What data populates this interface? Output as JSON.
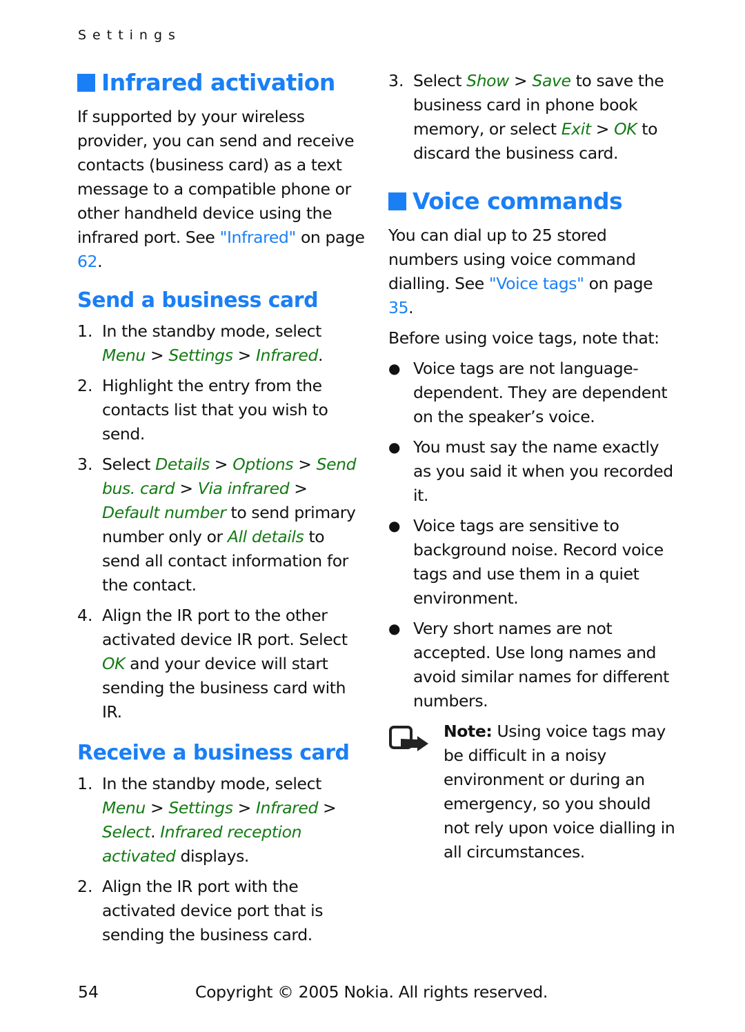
{
  "running_head": "Settings",
  "left": {
    "infrared_activation": {
      "title": "Infrared activation",
      "body_pre": "If supported by your wireless provider, you can send and receive contacts (business card) as a text message to a compatible phone or other handheld device using the infrared port. See ",
      "link_text": "\"Infrared\"",
      "on_page": " on page ",
      "page_ref": "62",
      "end": "."
    },
    "send": {
      "title": "Send a business card",
      "steps": [
        {
          "num": "1.",
          "t1": "In the standby mode, select ",
          "menu": "Menu",
          "sep1": " > ",
          "settings": "Settings",
          "sep2": " > ",
          "infrared": "Infrared",
          "end": "."
        },
        {
          "num": "2.",
          "text": "Highlight the entry from the contacts list that you wish to send."
        },
        {
          "num": "3.",
          "t1": "Select ",
          "details": "Details",
          "sep1": " > ",
          "options": "Options",
          "sep2": " > ",
          "send": "Send bus. card",
          "sep3": " > ",
          "via": "Via infrared",
          "sep4": " > ",
          "default": "Default number",
          "t2": " to send primary number only or ",
          "all": "All details",
          "t3": " to send all contact information for the contact."
        },
        {
          "num": "4.",
          "t1": "Align the IR port to the other activated device IR port. Select ",
          "ok": "OK",
          "t2": " and your device will start sending the business card with IR."
        }
      ]
    },
    "receive": {
      "title": "Receive a business card",
      "steps": [
        {
          "num": "1.",
          "t1": "In the standby mode, select ",
          "menu": "Menu",
          "sep1": " > ",
          "settings": "Settings",
          "sep2": " > ",
          "infrared": "Infrared",
          "sep3": " > ",
          "select": "Select",
          "dot": ". ",
          "reception": "Infrared reception activated",
          "t2": " displays."
        },
        {
          "num": "2.",
          "text": "Align the IR port with the activated device port that is sending the business card."
        }
      ]
    }
  },
  "right": {
    "receive_step3": {
      "num": "3.",
      "t1": "Select ",
      "show": "Show",
      "sep1": " > ",
      "save": "Save",
      "t2": " to save the business card in phone book memory, or select ",
      "exit": "Exit",
      "sep2": " > ",
      "ok": "OK",
      "t3": " to discard the business card."
    },
    "voice": {
      "title": "Voice commands",
      "intro_pre": "You can dial up to 25 stored numbers using voice command dialling. See ",
      "link_text": "\"Voice tags\"",
      "on_page": " on page ",
      "page_ref": "35",
      "end": ".",
      "before": "Before using voice tags, note that:",
      "bullet_glyph": "●",
      "bullets": [
        "Voice tags are not language-dependent. They are dependent on the speaker’s voice.",
        "You must say the name exactly as you said it when you recorded it.",
        "Voice tags are sensitive to background noise. Record voice tags and use them in a quiet environment.",
        "Very short names are not accepted. Use long names and avoid similar names for different numbers."
      ],
      "note_label": "Note:",
      "note_text": " Using voice tags may be difficult in a noisy environment or during an emergency, so you should not rely upon voice dialling in all circumstances."
    }
  },
  "footer": {
    "page_number": "54",
    "copyright": "Copyright © 2005 Nokia. All rights reserved."
  },
  "colors": {
    "heading": "#1a7ff5",
    "ui_term": "#137a13",
    "text": "#111111"
  }
}
